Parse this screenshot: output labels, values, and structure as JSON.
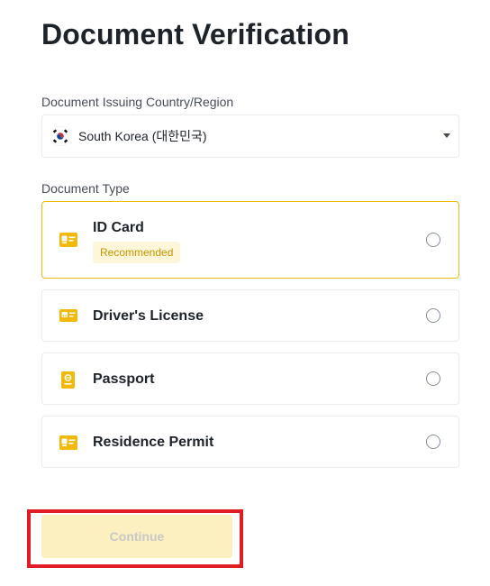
{
  "page": {
    "title": "Document Verification"
  },
  "country": {
    "label": "Document Issuing Country/Region",
    "selected_value": "South Korea (대한민국)",
    "flag_icon": "south-korea-flag-icon"
  },
  "document_type": {
    "label": "Document Type",
    "options": [
      {
        "label": "ID Card",
        "badge": "Recommended",
        "icon": "id-card-icon",
        "selected": true
      },
      {
        "label": "Driver's License",
        "icon": "drivers-license-icon",
        "selected": false
      },
      {
        "label": "Passport",
        "icon": "passport-icon",
        "selected": false
      },
      {
        "label": "Residence Permit",
        "icon": "residence-permit-icon",
        "selected": false
      }
    ]
  },
  "actions": {
    "continue_label": "Continue",
    "continue_enabled": false
  },
  "colors": {
    "accent": "#f0b90b",
    "badge_bg": "#fef6d8",
    "badge_text": "#c99400",
    "button_disabled_bg": "#fcf0c0",
    "highlight": "#e01c24"
  }
}
